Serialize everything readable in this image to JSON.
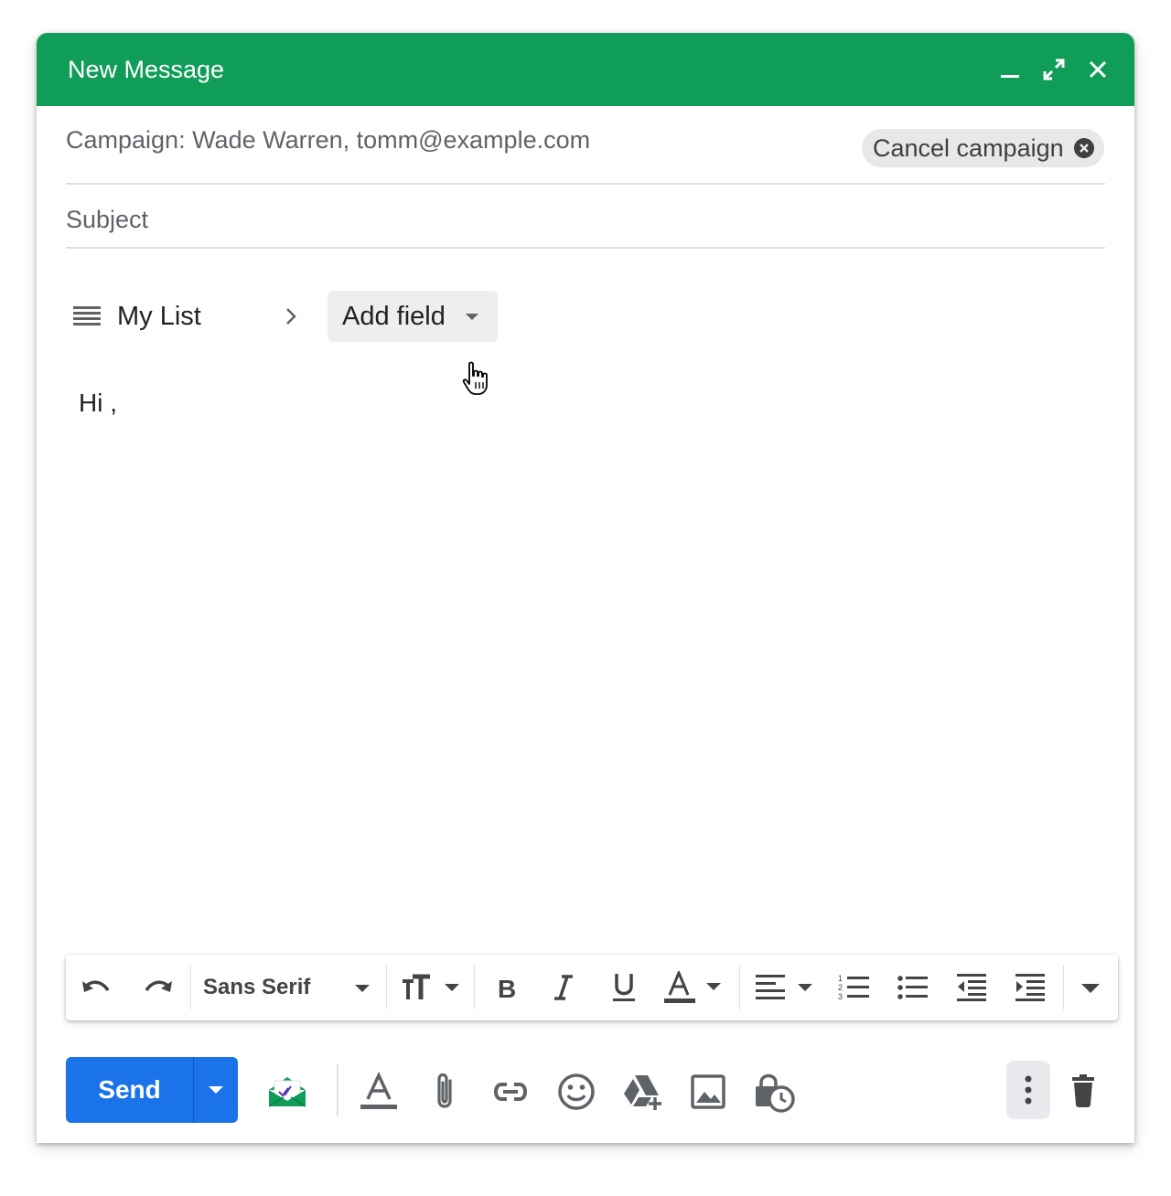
{
  "window": {
    "title": "New Message",
    "accent_color": "#0f9d58",
    "controls": [
      "minimize-icon",
      "expand-icon",
      "close-icon"
    ]
  },
  "recipients": {
    "text": "Campaign: Wade Warren, tomm@example.com",
    "cancel_chip_label": "Cancel campaign",
    "cancel_chip_icon": "cancel-circle-icon"
  },
  "subject": {
    "placeholder": "Subject",
    "value": ""
  },
  "breadcrumb": {
    "list_icon": "list-icon",
    "list_label": "My List",
    "separator_icon": "chevron-right-icon",
    "add_field_label": "Add field",
    "add_field_icon": "caret-down-icon"
  },
  "body": {
    "text": "Hi ,"
  },
  "format_toolbar": {
    "font_family": "Sans Serif",
    "icons": [
      "undo-icon",
      "redo-icon",
      "font-size-icon",
      "bold-icon",
      "italic-icon",
      "underline-icon",
      "text-color-icon",
      "align-icon",
      "numbered-list-icon",
      "bulleted-list-icon",
      "indent-less-icon",
      "indent-more-icon",
      "more-formatting-icon"
    ],
    "text_color_bar": "#444444"
  },
  "bottom_toolbar": {
    "send_label": "Send",
    "send_color": "#1a73e8",
    "icons": [
      "campaign-mail-icon",
      "formatting-options-icon",
      "attach-icon",
      "link-icon",
      "emoji-icon",
      "drive-icon",
      "photo-icon",
      "confidential-mode-icon",
      "more-options-icon",
      "trash-icon"
    ]
  }
}
